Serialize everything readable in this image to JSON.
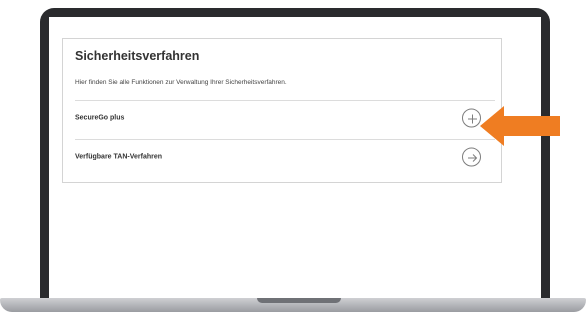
{
  "card": {
    "title": "Sicherheitsverfahren",
    "description": "Hier finden Sie alle Funktionen zur Verwaltung Ihrer Sicherheitsverfahren."
  },
  "rows": [
    {
      "label": "SecureGo plus",
      "action_icon": "plus-icon"
    },
    {
      "label": "Verfügbare TAN-Verfahren",
      "action_icon": "arrow-right-icon"
    }
  ],
  "colors": {
    "highlight_arrow": "#ef7d22",
    "laptop_body": "#2a2b2e"
  }
}
